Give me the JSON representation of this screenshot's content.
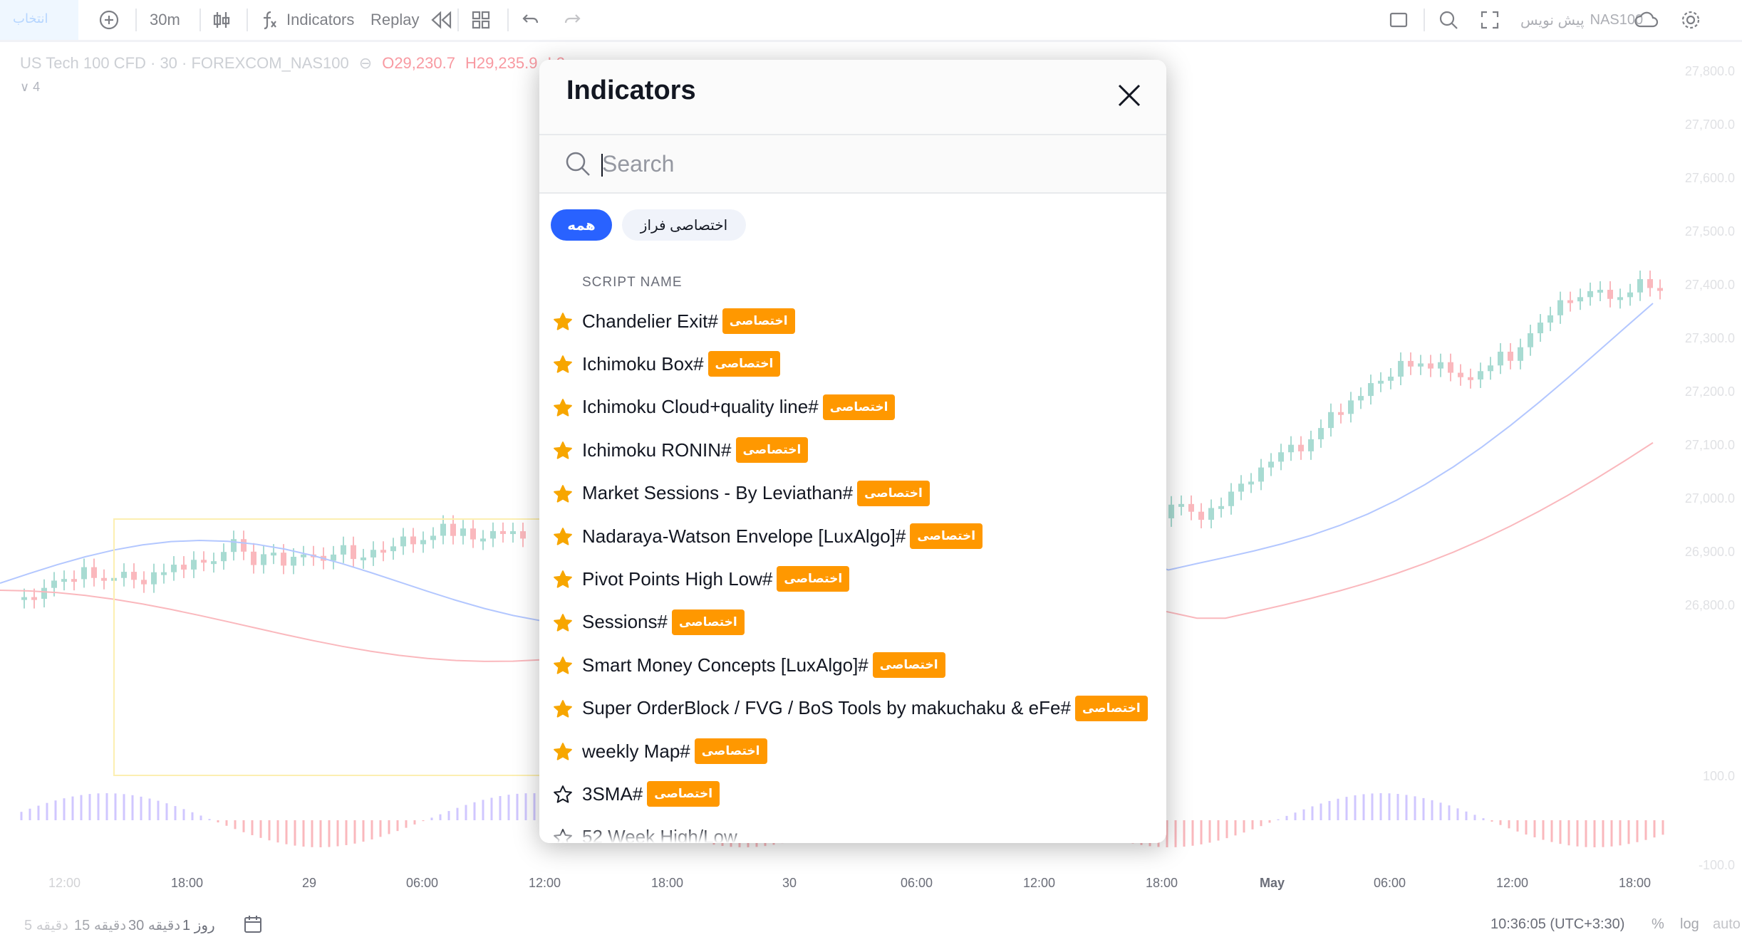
{
  "toolbar": {
    "ticker_box_label": "انتخاب",
    "interval": "30m",
    "indicators_label": "Indicators",
    "replay_label": "Replay",
    "symbol_label": "NAS100",
    "publish_label": "پیش نویس"
  },
  "chart": {
    "symbol_line": "US Tech 100 CFD · 30 · FOREXCOM_NAS100",
    "open": "O29,230.7",
    "high": "H29,235.9",
    "low": "L2",
    "sub_legend": "∨ 4",
    "price_labels": [
      "27,800.0",
      "27,700.0",
      "27,600.0",
      "27,500.0",
      "27,400.0",
      "27,300.0",
      "27,200.0",
      "27,100.0",
      "27,000.0",
      "26,900.0",
      "26,800.0"
    ],
    "indicator_top": "100.0",
    "indicator_bottom": "-100.0",
    "time_labels": [
      "12:00",
      "18:00",
      "29",
      "06:00",
      "12:00",
      "18:00",
      "30",
      "06:00",
      "12:00",
      "18:00",
      "May",
      "06:00",
      "12:00",
      "18:00"
    ],
    "colors": {
      "up": "#089981",
      "down": "#f23645",
      "accent": "#2962ff"
    }
  },
  "bottom_bar": {
    "ranges": [
      "5 دقیقه",
      "15 دقیقه",
      "30 دقیقه",
      "1 روز"
    ],
    "clock": "10:36:05 (UTC+3:30)",
    "percent": "%",
    "log": "log",
    "auto": "auto"
  },
  "modal": {
    "title": "Indicators",
    "search_placeholder": "Search",
    "tabs": {
      "all": "همه",
      "private": "اختصاصی فراز"
    },
    "column_header": "SCRIPT NAME",
    "badge_label": "اختصاصی",
    "items": [
      {
        "name": "Chandelier Exit#",
        "favorite": true
      },
      {
        "name": "Ichimoku Box#",
        "favorite": true
      },
      {
        "name": "Ichimoku Cloud+quality line#",
        "favorite": true
      },
      {
        "name": "Ichimoku RONIN#",
        "favorite": true
      },
      {
        "name": "Market Sessions - By Leviathan#",
        "favorite": true
      },
      {
        "name": "Nadaraya-Watson Envelope [LuxAlgo]#",
        "favorite": true
      },
      {
        "name": "Pivot Points High Low#",
        "favorite": true
      },
      {
        "name": "Sessions#",
        "favorite": true
      },
      {
        "name": "Smart Money Concepts [LuxAlgo]#",
        "favorite": true
      },
      {
        "name": "Super OrderBlock / FVG / BoS Tools by makuchaku & eFe#",
        "favorite": true
      },
      {
        "name": "weekly Map#",
        "favorite": true
      },
      {
        "name": "3SMA#",
        "favorite": false
      },
      {
        "name": "52 Week High/Low",
        "favorite": false
      }
    ]
  }
}
